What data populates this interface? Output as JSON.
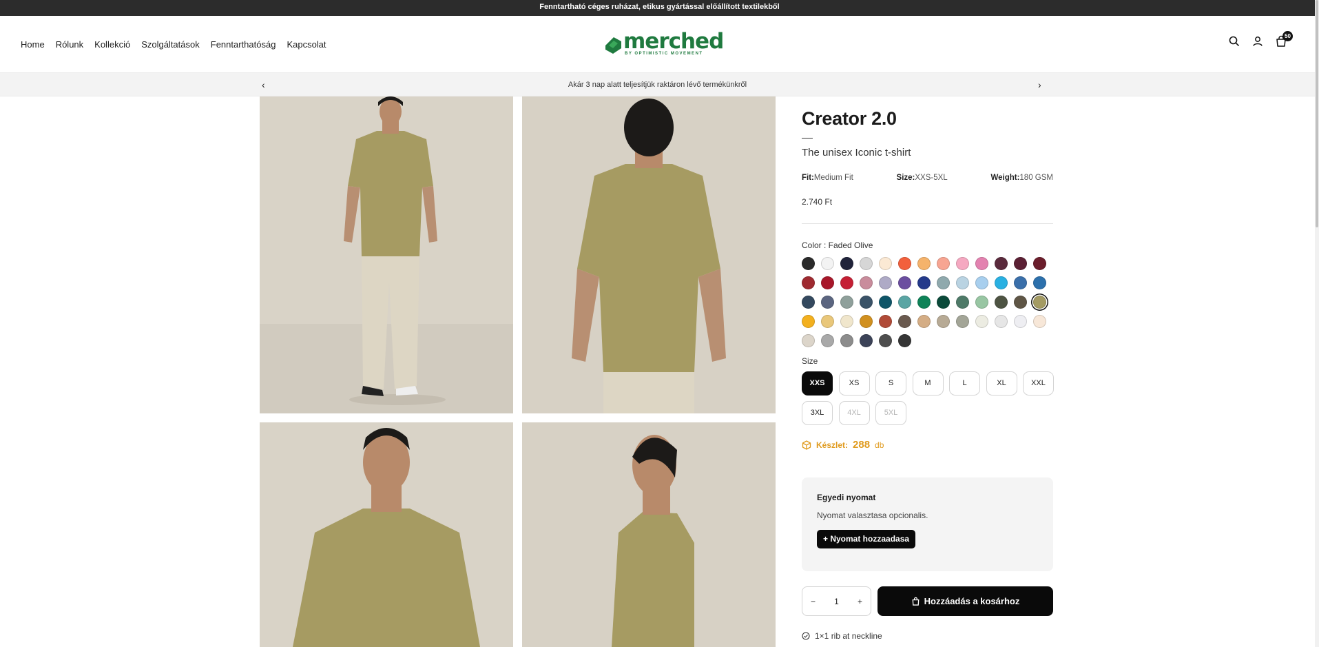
{
  "announcement": "Fenntartható céges ruházat, etikus gyártással előállított textilekből",
  "nav": [
    "Home",
    "Rólunk",
    "Kollekció",
    "Szolgáltatások",
    "Fenntarthatóság",
    "Kapcsolat"
  ],
  "logo": {
    "word": "merched",
    "tagline": "BY OPTIMISTIC MOVEMENT",
    "color": "#1f7a3f"
  },
  "header_icons": [
    "search-icon",
    "user-icon",
    "cart-icon"
  ],
  "cart_count": "50",
  "promo": {
    "text": "Akár 3 nap alatt teljesítjük raktáron lévő termékünkről",
    "prev": "‹",
    "next": "›"
  },
  "product": {
    "title": "Creator 2.0",
    "subtitle": "The unisex Iconic t-shirt",
    "specs": [
      {
        "label": "Fit:",
        "value": "Medium Fit"
      },
      {
        "label": "Size:",
        "value": "XXS-5XL"
      },
      {
        "label": "Weight:",
        "value": "180 GSM"
      }
    ],
    "price": "2.740 Ft",
    "color_label": "Color : Faded Olive",
    "swatches": [
      "#2b2b2b",
      "#f3f3f3",
      "#20233a",
      "#d6d6d6",
      "#fbe9d4",
      "#f2603c",
      "#f5b36b",
      "#f7a592",
      "#f5a8c1",
      "#e382b0",
      "#5a2a3c",
      "#5b2034",
      "#6b1e2c",
      "#9f2a30",
      "#a8172a",
      "#c51f34",
      "#c98c9c",
      "#aeaac6",
      "#6b4ea0",
      "#243a8b",
      "#8fa9ad",
      "#b9d3e2",
      "#a8cfee",
      "#29b0e2",
      "#3a6faa",
      "#2c70ac",
      "#34495f",
      "#5b6580",
      "#8fa09b",
      "#3a5368",
      "#0f5568",
      "#5aa5a4",
      "#0e8358",
      "#0b4a3a",
      "#4e7a68",
      "#98c6a3",
      "#4e5443",
      "#5f5646",
      "#a49b63",
      "#f3b01e",
      "#e9c77a",
      "#f0e6cc",
      "#d1901f",
      "#b04a37",
      "#6a5a4f",
      "#d4ad85",
      "#b7aa95",
      "#a3a597",
      "#ecece2",
      "#e6e6e6",
      "#eeeef2",
      "#f7e7d8",
      "#dcd5ca",
      "#a9a9a9",
      "#8c8c8c",
      "#3c4358",
      "#4e4e4e",
      "#353535"
    ],
    "selected_swatch": 38,
    "size_label": "Size",
    "sizes": [
      "XXS",
      "XS",
      "S",
      "M",
      "L",
      "XL",
      "XXL",
      "3XL",
      "4XL",
      "5XL"
    ],
    "active_size": "XXS",
    "disabled_sizes": [
      "4XL",
      "5XL"
    ],
    "stock": {
      "label": "Készlet:",
      "count": "288",
      "unit": "db",
      "color": "#e09b1f"
    },
    "custom_print": {
      "title": "Egyedi nyomat",
      "desc": "Nyomat valasztasa opcionalis.",
      "button": "+ Nyomat hozzaadasa"
    },
    "quantity": "1",
    "qty_minus": "−",
    "qty_plus": "+",
    "add_to_cart": "Hozzáadás a kosárhoz",
    "feature": "1×1 rib at neckline"
  }
}
